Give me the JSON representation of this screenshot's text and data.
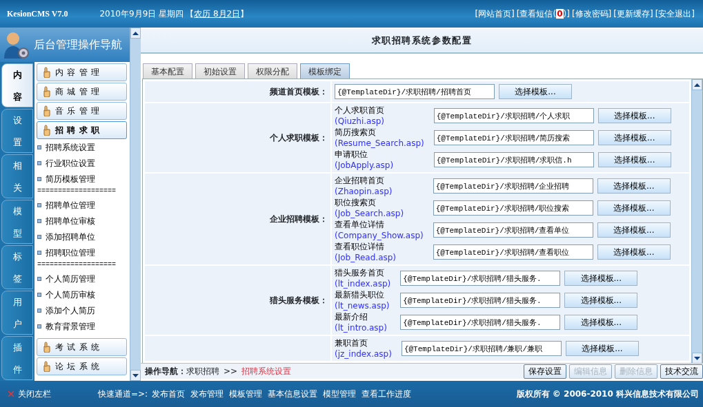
{
  "header": {
    "logo": "KesionCMS V7.0",
    "date": "2010年9月9日 星期四",
    "lunar_open": "【",
    "lunar": "农历 8月2日",
    "lunar_close": "】",
    "links": [
      {
        "text": "[网站首页]"
      },
      {
        "text": "[查看短信(",
        "count": "0",
        "after": ")]"
      },
      {
        "text": "[修改密码]"
      },
      {
        "text": "[更新缓存]"
      },
      {
        "text": "[安全退出]"
      }
    ]
  },
  "sidebar": {
    "title": "后台管理操作导航",
    "tabs": [
      {
        "label": "内容",
        "selected": true
      },
      {
        "label": "设置",
        "selected": false
      },
      {
        "label": "相关",
        "selected": false
      },
      {
        "label": "模型",
        "selected": false
      },
      {
        "label": "标签",
        "selected": false
      },
      {
        "label": "用户",
        "selected": false
      },
      {
        "label": "插件",
        "selected": false
      }
    ],
    "groups": [
      {
        "label": "内容管理",
        "expanded": false
      },
      {
        "label": "商城管理",
        "expanded": false
      },
      {
        "label": "音乐管理",
        "expanded": false
      },
      {
        "label": "招聘求职",
        "expanded": true,
        "children": [
          {
            "kind": "link",
            "label": "招聘系统设置"
          },
          {
            "kind": "link",
            "label": "行业职位设置"
          },
          {
            "kind": "link",
            "label": "简历模板管理"
          },
          {
            "kind": "separator",
            "label": "==================="
          },
          {
            "kind": "link",
            "label": "招聘单位管理"
          },
          {
            "kind": "link",
            "label": "招聘单位审核"
          },
          {
            "kind": "link",
            "label": "添加招聘单位"
          },
          {
            "kind": "link",
            "label": "招聘职位管理"
          },
          {
            "kind": "separator",
            "label": "==================="
          },
          {
            "kind": "link",
            "label": "个人简历管理"
          },
          {
            "kind": "link",
            "label": "个人简历审核"
          },
          {
            "kind": "link",
            "label": "添加个人简历"
          },
          {
            "kind": "link",
            "label": "教育背景管理"
          }
        ]
      },
      {
        "label": "考试系统",
        "expanded": false
      },
      {
        "label": "论坛系统",
        "expanded": false
      }
    ]
  },
  "page": {
    "title": "求职招聘系统参数配置",
    "tabs": [
      {
        "label": "基本配置",
        "selected": false
      },
      {
        "label": "初始设置",
        "selected": false
      },
      {
        "label": "权限分配",
        "selected": false
      },
      {
        "label": "模板绑定",
        "selected": true
      }
    ],
    "sections": [
      {
        "label": "频道首页模板：",
        "items": [
          {
            "value": "{@TemplateDir}/求职招聘/招聘首页",
            "button": "选择模板..."
          }
        ]
      },
      {
        "label": "个人求职模板：",
        "items": [
          {
            "title": "个人求职首页",
            "file": "(Qiuzhi.asp)",
            "value": "{@TemplateDir}/求职招聘/个人求职",
            "button": "选择模板..."
          },
          {
            "title": "简历搜索页",
            "file": "(Resume_Search.asp)",
            "value": "{@TemplateDir}/求职招聘/简历搜索",
            "button": "选择模板..."
          },
          {
            "title": "申请职位",
            "file": "(JobApply.asp)",
            "value": "{@TemplateDir}/求职招聘/求职信.h",
            "button": "选择模板..."
          }
        ]
      },
      {
        "label": "企业招聘模板：",
        "items": [
          {
            "title": "企业招聘首页",
            "file": "(Zhaopin.asp)",
            "value": "{@TemplateDir}/求职招聘/企业招聘",
            "button": "选择模板..."
          },
          {
            "title": "职位搜索页",
            "file": "(Job_Search.asp)",
            "value": "{@TemplateDir}/求职招聘/职位搜索",
            "button": "选择模板..."
          },
          {
            "title": "查看单位详情",
            "file": "(Company_Show.asp)",
            "value": "{@TemplateDir}/求职招聘/查看单位",
            "button": "选择模板..."
          },
          {
            "title": "查看职位详情",
            "file": "(Job_Read.asp)",
            "value": "{@TemplateDir}/求职招聘/查看职位",
            "button": "选择模板..."
          }
        ]
      },
      {
        "label": "猎头服务模板：",
        "items": [
          {
            "title": "猎头服务首页",
            "file": "(lt_index.asp)",
            "value": "{@TemplateDir}/求职招聘/猎头服务.",
            "button": "选择模板..."
          },
          {
            "title": "最新猎头职位",
            "file": "(lt_news.asp)",
            "value": "{@TemplateDir}/求职招聘/猎头服务.",
            "button": "选择模板..."
          },
          {
            "title": "最新介绍",
            "file": "(lt_intro.asp)",
            "value": "{@TemplateDir}/求职招聘/猎头服务.",
            "button": "选择模板..."
          }
        ]
      },
      {
        "items": [
          {
            "title": "兼职首页",
            "file": "(jz_index.asp)",
            "value": "{@TemplateDir}/求职招聘/兼职/兼职",
            "button": "选择模板..."
          }
        ]
      }
    ]
  },
  "breadcrumb": {
    "label": "操作导航：",
    "path": "求职招聘",
    "sep": ">>",
    "current": "招聘系统设置"
  },
  "actions": [
    {
      "label": "保存设置",
      "disabled": false
    },
    {
      "label": "编辑信息",
      "disabled": true
    },
    {
      "label": "删除信息",
      "disabled": true
    },
    {
      "label": "技术交流",
      "disabled": false
    }
  ],
  "footer": {
    "close": "关闭左栏",
    "quick_label": "快速通道=>:",
    "quick_links": [
      "发布首页",
      "发布管理",
      "模板管理",
      "基本信息设置",
      "模型管理",
      "查看工作进度"
    ],
    "copyright": "版权所有 © 2006-2010 科兴信息技术有限公司"
  }
}
